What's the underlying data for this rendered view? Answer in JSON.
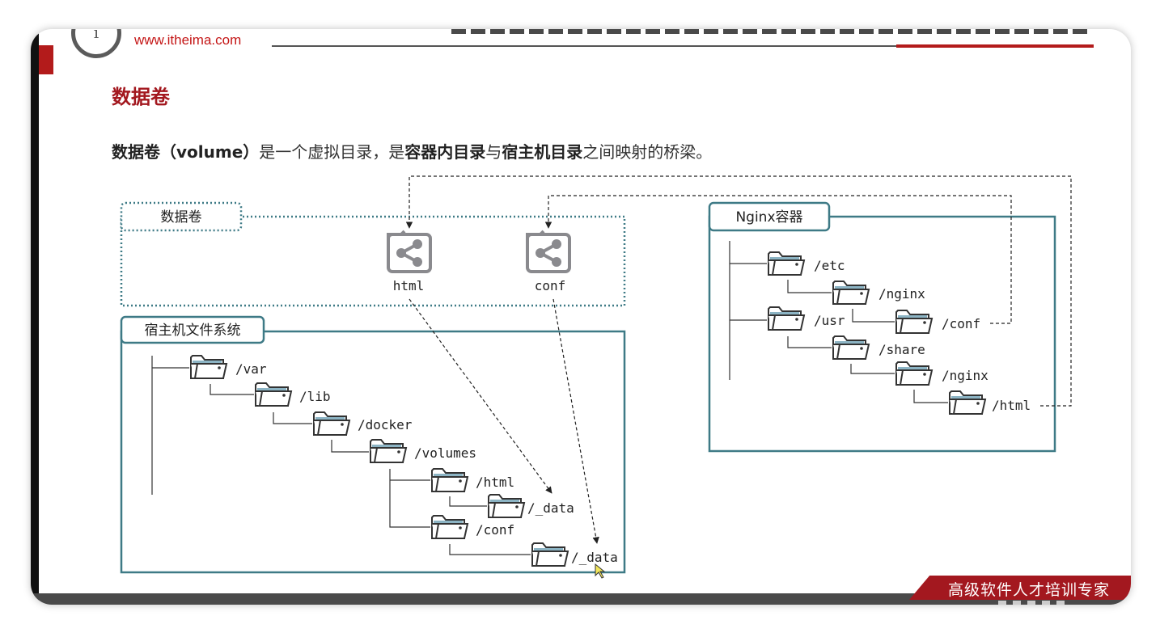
{
  "header": {
    "logo_url": "www.itheima.com"
  },
  "slide": {
    "title": "数据卷",
    "description": {
      "part1": "数据卷（volume）",
      "part2": "是一个虚拟目录，是",
      "part3": "容器内目录",
      "part4": "与",
      "part5": "宿主机目录",
      "part6": "之间映射的桥梁。"
    }
  },
  "diagram": {
    "volume_box": {
      "label": "数据卷",
      "items": [
        "html",
        "conf"
      ]
    },
    "host_box": {
      "label": "宿主机文件系统",
      "folders": [
        "/var",
        "/lib",
        "/docker",
        "/volumes",
        "/html",
        "/_data",
        "/conf",
        "/_data"
      ]
    },
    "container_box": {
      "label": "Nginx容器",
      "folders": [
        "/etc",
        "/nginx",
        "/usr",
        "/conf",
        "/share",
        "/nginx",
        "/html"
      ]
    },
    "colors": {
      "box_border": "#3e7a86",
      "folder_fill": "#8cb4c4",
      "folder_stroke": "#333333",
      "icon_gray": "#8a8a8e"
    }
  },
  "footer": {
    "text": "高级软件人才培训专家"
  }
}
